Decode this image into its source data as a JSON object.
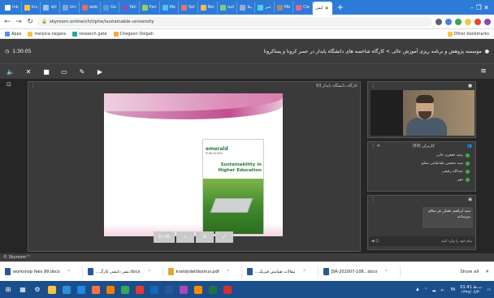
{
  "browser": {
    "tabs": [
      {
        "label": "Inb",
        "color": "#ffffff"
      },
      {
        "label": "Inv",
        "color": "#f4c542"
      },
      {
        "label": "sbl",
        "color": "#9cc2ee"
      },
      {
        "label": "Uni",
        "color": "#7aa7e0"
      },
      {
        "label": "web",
        "color": "#e46d6d"
      },
      {
        "label": "Go",
        "color": "#5b9bd5"
      },
      {
        "label": "Yah",
        "color": "#7e57c2"
      },
      {
        "label": "Fen",
        "color": "#9ccc65"
      },
      {
        "label": "Me",
        "color": "#4fc3f7"
      },
      {
        "label": "Sel",
        "color": "#e57373"
      },
      {
        "label": "Ber",
        "color": "#ffb74d"
      },
      {
        "label": "out",
        "color": "#81c784"
      },
      {
        "label": "یبلا",
        "color": "#9fa8da"
      },
      {
        "label": "خبر",
        "color": "#4dd0e1"
      },
      {
        "label": "Mb",
        "color": "#a1887f"
      },
      {
        "label": "Cle",
        "color": "#f06292"
      }
    ],
    "active_tab": {
      "label": "ایمن"
    },
    "url": "skyroom.online/ch/irphe/sustainable-university",
    "bookmarks": [
      {
        "label": "Apps",
        "color": "#5b8def"
      },
      {
        "label": "melyica negara",
        "color": "#f4c542"
      },
      {
        "label": "research gate",
        "color": "#1fa9a0"
      },
      {
        "label": "Chegoon Dolgah",
        "color": "#f4a742"
      }
    ],
    "other_bookmarks": "Other bookmarks"
  },
  "app": {
    "timer": "1:30:05",
    "room_title": "موسسه پژوهش و برنامه ریزی آموزش عالی > کارگاه شاخصه های دانشگاه پایدار در عصر کرونا و پساکرونا",
    "presentation_title": "کارگاه دانشگاه پایدار 93",
    "page_indicator": "9 / 45",
    "book": {
      "logo": "emerald",
      "subtitle": "PUBLISHING",
      "title": "Sustainability in Higher Education"
    },
    "users_panel_title": "کاربران (59)",
    "users": [
      "رقیه جعفری خانی",
      "سید محسن طباطبایی مملو",
      "عبدالله رقیقی",
      "مهر"
    ],
    "chat_message": "سید ابراهیم عقیلی فر سلام میرسانند",
    "chat_placeholder": "پیام خود را وارد کنید",
    "footer_brand": "© Skyroom™"
  },
  "downloads": [
    {
      "name": "workshop fees 99.docx",
      "color": "#2b579a"
    },
    {
      "name": "...نشر دانشی کارگ.docx",
      "color": "#2b579a"
    },
    {
      "name": "kratdydelidosirus.pdf",
      "color": "#e2a72c"
    },
    {
      "name": "...مقالات همایش فیزیک",
      "color": "#2b579a"
    },
    {
      "name": "JSR-202007-108...docx",
      "color": "#2b579a"
    }
  ],
  "downloads_show_all": "Show all",
  "taskbar": {
    "apps": [
      {
        "icon": "file-explorer-icon",
        "color": "#f4c542"
      },
      {
        "icon": "edge-icon",
        "color": "#2f8fdb"
      },
      {
        "icon": "store-icon",
        "color": "#1e88e5"
      },
      {
        "icon": "mail-icon",
        "color": "#ff7043"
      },
      {
        "icon": "vlc-icon",
        "color": "#f57c00"
      },
      {
        "icon": "chrome-icon",
        "color": "#34a853"
      },
      {
        "icon": "opera-icon",
        "color": "#e53935"
      },
      {
        "icon": "outlook-icon",
        "color": "#1565c0"
      },
      {
        "icon": "word-icon",
        "color": "#2b579a"
      },
      {
        "icon": "photos-icon",
        "color": "#ab47bc"
      },
      {
        "icon": "paint-icon",
        "color": "#fb8c00"
      },
      {
        "icon": "excel-icon",
        "color": "#217346"
      },
      {
        "icon": "acrobat-icon",
        "color": "#d32f2f"
      }
    ],
    "lang": "FA",
    "time": "01:41 ب.ظ",
    "date": "۱۳۹۹/۰۶/۳۰"
  }
}
